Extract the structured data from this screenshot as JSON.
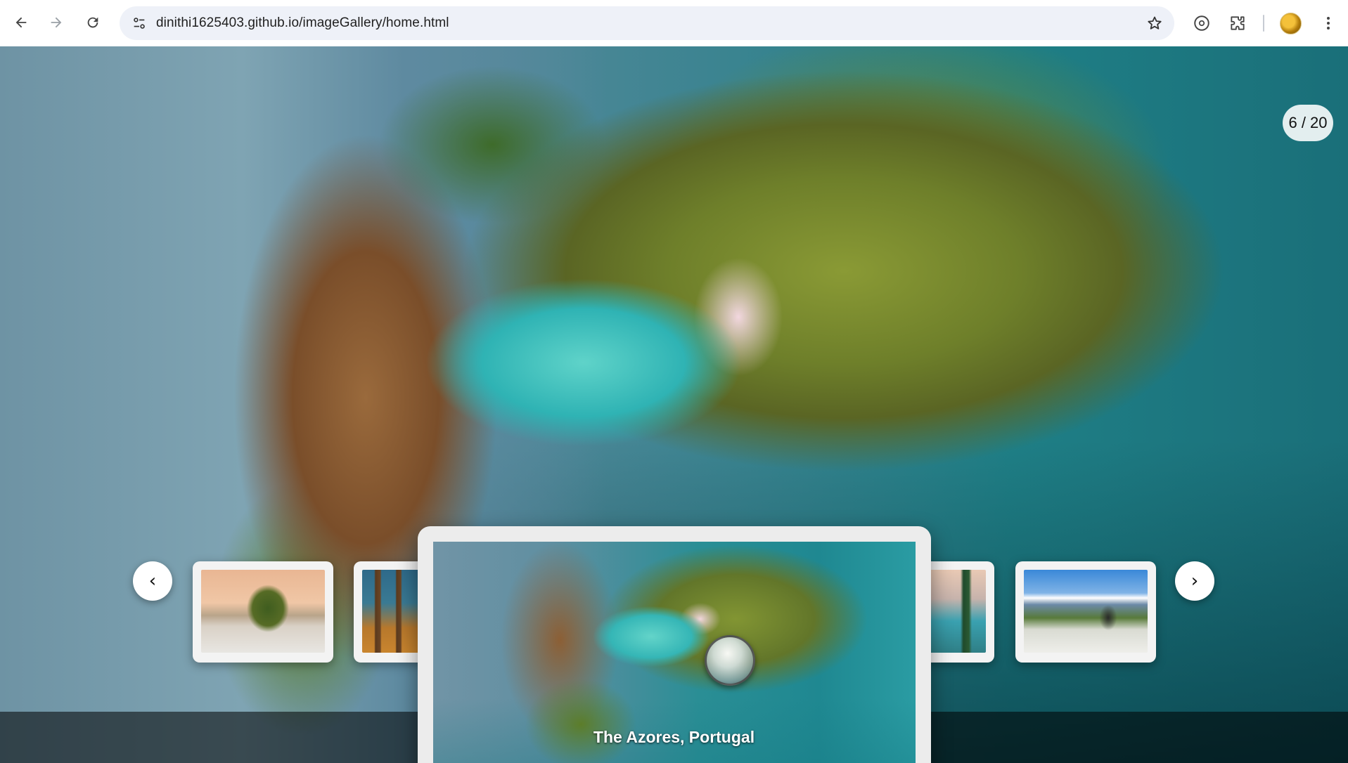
{
  "browser": {
    "url": "dinithi1625403.github.io/imageGallery/home.html",
    "icons": {
      "back": "arrow-left-icon",
      "forward": "arrow-right-icon",
      "reload": "reload-icon",
      "site_info": "tune-icon",
      "bookmark": "star-icon",
      "extension_1": "lens-icon",
      "extensions": "puzzle-icon",
      "profile": "avatar",
      "menu": "kebab-menu-icon"
    }
  },
  "gallery": {
    "counter": "6 / 20",
    "prev_arrow": "‹",
    "next_arrow": "›",
    "active_caption": "The Azores, Portugal",
    "thumbnails": [
      {
        "scene": "limestone-islands-sunset"
      },
      {
        "scene": "baobab-trees"
      },
      {
        "scene": "the-azores-portugal",
        "active": true
      },
      {
        "scene": "mountain-lake-pines"
      },
      {
        "scene": "coastal-mountain-snow"
      }
    ]
  }
}
